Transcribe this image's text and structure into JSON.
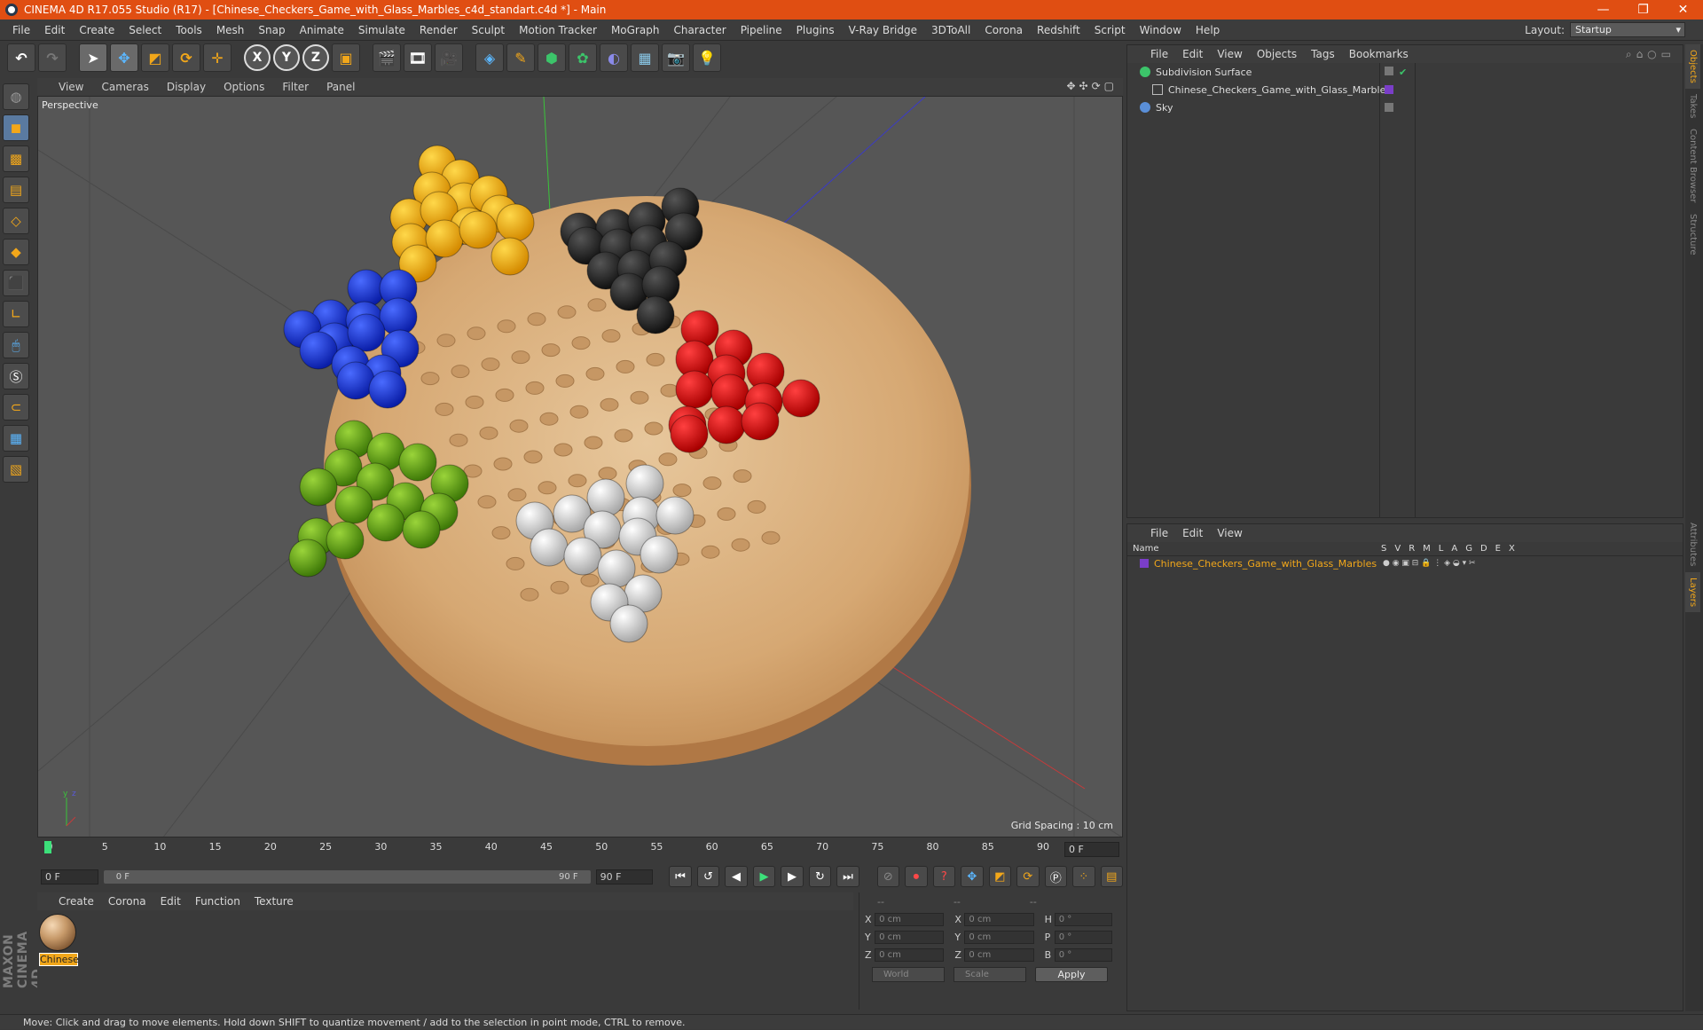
{
  "app": {
    "title": "CINEMA 4D R17.055 Studio (R17) - [Chinese_Checkers_Game_with_Glass_Marbles_c4d_standart.c4d *] - Main",
    "window_buttons": [
      "—",
      "❐",
      "✕"
    ]
  },
  "menu": [
    "File",
    "Edit",
    "Create",
    "Select",
    "Tools",
    "Mesh",
    "Snap",
    "Animate",
    "Simulate",
    "Render",
    "Sculpt",
    "Motion Tracker",
    "MoGraph",
    "Character",
    "Pipeline",
    "Plugins",
    "V-Ray Bridge",
    "3DToAll",
    "Corona",
    "Redshift",
    "Script",
    "Window",
    "Help"
  ],
  "layout": {
    "label": "Layout:",
    "value": "Startup"
  },
  "toolbar": {
    "undo_icon": "undo-icon",
    "redo_icon": "redo-icon",
    "axis_x": "X",
    "axis_y": "Y",
    "axis_z": "Z"
  },
  "viewport": {
    "menu": [
      "View",
      "Cameras",
      "Display",
      "Options",
      "Filter",
      "Panel"
    ],
    "label": "Perspective",
    "grid_spacing": "Grid Spacing : 10 cm"
  },
  "timeline": {
    "ticks": [
      "0",
      "5",
      "10",
      "15",
      "20",
      "25",
      "30",
      "35",
      "40",
      "45",
      "50",
      "55",
      "60",
      "65",
      "70",
      "75",
      "80",
      "85",
      "90"
    ],
    "current_frame": "0 F"
  },
  "transport": {
    "start": "0 F",
    "range_start": "0 F",
    "range_end": "90 F",
    "end": "90 F"
  },
  "material_manager": {
    "menu": [
      "Create",
      "Corona",
      "Edit",
      "Function",
      "Texture"
    ],
    "materials": [
      {
        "name": "Chinese"
      }
    ]
  },
  "coordinates": {
    "headers": [
      "--",
      "--",
      "--"
    ],
    "rows": [
      {
        "a": "X",
        "av": "0 cm",
        "b": "X",
        "bv": "0 cm",
        "c": "H",
        "cv": "0 °"
      },
      {
        "a": "Y",
        "av": "0 cm",
        "b": "Y",
        "bv": "0 cm",
        "c": "P",
        "cv": "0 °"
      },
      {
        "a": "Z",
        "av": "0 cm",
        "b": "Z",
        "bv": "0 cm",
        "c": "B",
        "cv": "0 °"
      }
    ],
    "mode": "World",
    "size_mode": "Scale",
    "apply": "Apply"
  },
  "status": "Move: Click and drag to move elements. Hold down SHIFT to quantize movement / add to the selection in point mode, CTRL to remove.",
  "object_manager": {
    "menu": [
      "File",
      "Edit",
      "View",
      "Objects",
      "Tags",
      "Bookmarks"
    ],
    "objects": [
      {
        "name": "Subdivision Surface",
        "icon_color": "#3cc46a"
      },
      {
        "name": "Chinese_Checkers_Game_with_Glass_Marbles",
        "icon_color": "#bbbbbb"
      },
      {
        "name": "Sky",
        "icon_color": "#5a8fd8"
      }
    ]
  },
  "layer_manager": {
    "menu": [
      "File",
      "Edit",
      "View"
    ],
    "name_header": "Name",
    "columns": [
      "S",
      "V",
      "R",
      "M",
      "L",
      "A",
      "G",
      "D",
      "E",
      "X"
    ],
    "layers": [
      {
        "name": "Chinese_Checkers_Game_with_Glass_Marbles",
        "color": "#7a3ec8"
      }
    ]
  },
  "side_tabs": [
    "Objects",
    "Takes",
    "Content Browser",
    "Structure"
  ],
  "side_tabs_lower": [
    "Attributes",
    "Layers"
  ],
  "colors": {
    "title_bar": "#e04e12",
    "accent": "#f2a71a",
    "marble_yellow": "#f2a900",
    "marble_black": "#2a2a2a",
    "marble_blue": "#1a3de0",
    "marble_red": "#e00c0c",
    "marble_green": "#6aa81a",
    "marble_white": "#d8d8d8"
  }
}
